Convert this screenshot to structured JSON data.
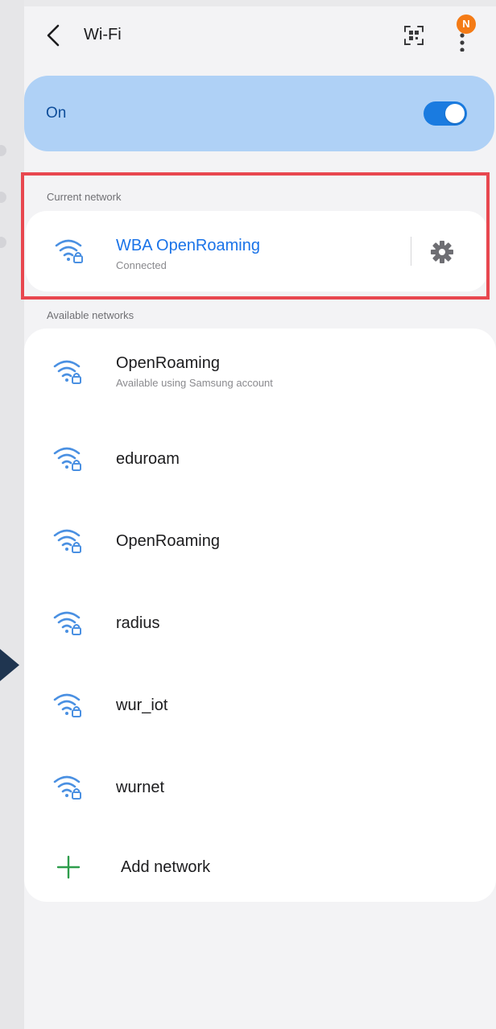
{
  "header": {
    "title": "Wi-Fi",
    "back_icon": "chevron-left-icon",
    "qr_icon": "qr-scan-icon",
    "more_icon": "more-vertical-icon",
    "notification_badge": "N"
  },
  "wifi_toggle": {
    "label": "On",
    "state": true,
    "accent_color": "#1a7be0"
  },
  "current_network": {
    "section_label": "Current network",
    "name": "WBA OpenRoaming",
    "status": "Connected",
    "icon": "wifi-lock-icon",
    "settings_icon": "gear-icon"
  },
  "available_networks": {
    "section_label": "Available networks",
    "items": [
      {
        "name": "OpenRoaming",
        "sub": "Available using Samsung account",
        "icon": "wifi-lock-icon"
      },
      {
        "name": "eduroam",
        "icon": "wifi-lock-icon"
      },
      {
        "name": "OpenRoaming",
        "icon": "wifi-lock-icon"
      },
      {
        "name": "radius",
        "icon": "wifi-lock-icon"
      },
      {
        "name": "wur_iot",
        "icon": "wifi-lock-icon"
      },
      {
        "name": "wurnet",
        "icon": "wifi-lock-icon"
      }
    ],
    "add_label": "Add network",
    "add_icon": "plus-icon"
  },
  "colors": {
    "link_blue": "#1a73e8",
    "toggle_bg": "#afd1f6",
    "highlight": "#e8474f",
    "badge": "#f47b16",
    "add_green": "#2e9d4c"
  }
}
